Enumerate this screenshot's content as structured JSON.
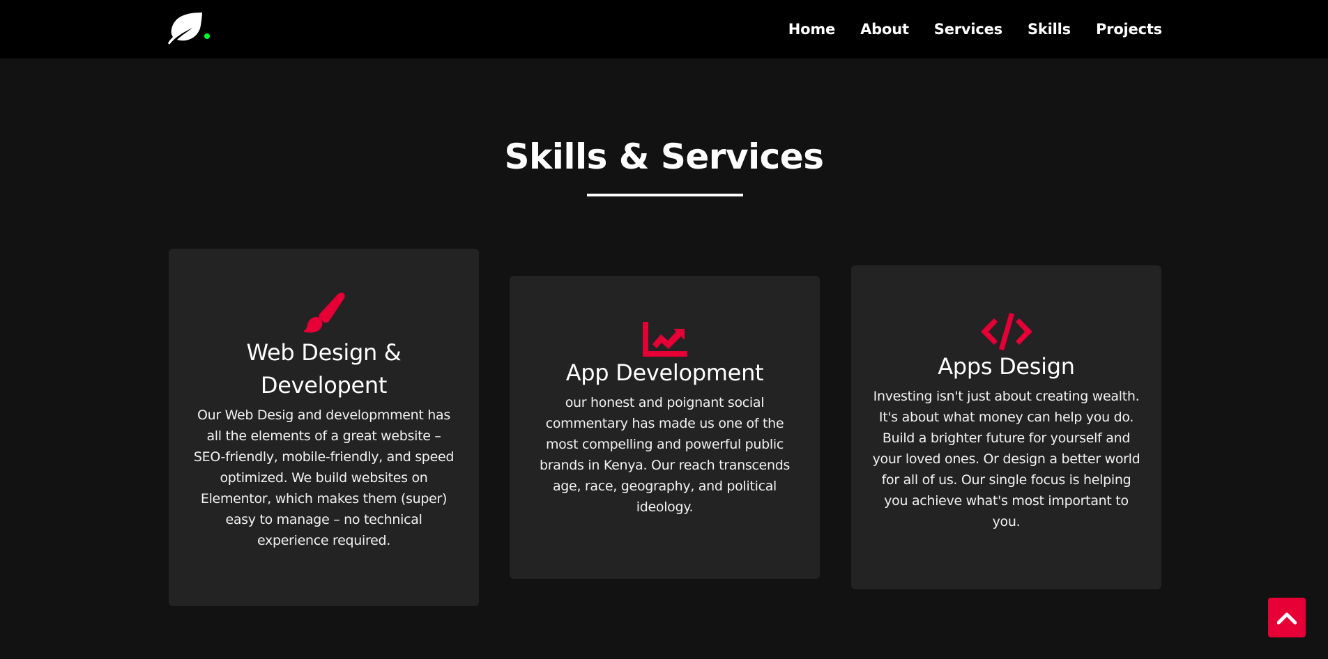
{
  "colors": {
    "background": "#121212",
    "navbar": "#000000",
    "card": "#232323",
    "accent": "#e60036",
    "logo_dot": "#00ff26"
  },
  "logo": {
    "icon": "leaf-icon"
  },
  "nav": {
    "items": [
      {
        "label": "Home"
      },
      {
        "label": "About"
      },
      {
        "label": "Services"
      },
      {
        "label": "Skills"
      },
      {
        "label": "Projects"
      }
    ]
  },
  "section": {
    "title": "Skills & Services"
  },
  "cards": [
    {
      "icon": "paint-brush-icon",
      "title": "Web Design & Developent",
      "text": "Our Web Desig and developmment has all the elements of a great website – SEO-friendly, mobile-friendly, and speed optimized. We build websites on Elementor, which makes them (super) easy to manage – no technical experience required."
    },
    {
      "icon": "chart-line-icon",
      "title": "App Development",
      "text": "our honest and poignant social commentary has made us one of the most compelling and powerful public brands in Kenya. Our reach transcends age, race, geography, and political ideology."
    },
    {
      "icon": "code-icon",
      "title": "Apps Design",
      "text": "Investing isn't just about creating wealth. It's about what money can help you do. Build a brighter future for yourself and your loved ones. Or design a better world for all of us. Our single focus is helping you achieve what's most important to you."
    }
  ],
  "scroll_top": {
    "icon": "chevron-up-icon"
  }
}
